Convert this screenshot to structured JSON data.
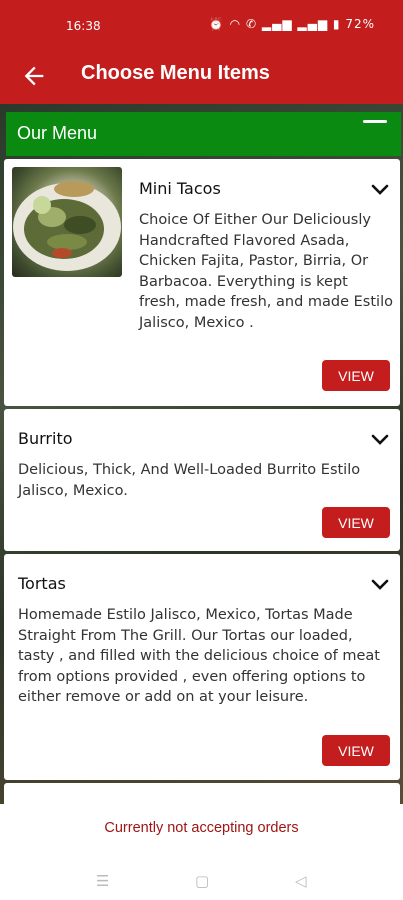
{
  "status_bar": {
    "time": "16:38",
    "icons": [
      "alarm-icon",
      "wifi-icon",
      "call-icon",
      "signal-icon",
      "signal-icon",
      "battery-icon"
    ],
    "battery": "72%"
  },
  "app_bar": {
    "title": "Choose Menu Items",
    "back_icon": "back-arrow-icon"
  },
  "menu_section": {
    "title": "Our Menu"
  },
  "items": [
    {
      "name": "Mini Tacos",
      "description": "Choice Of Either Our Deliciously Handcrafted Flavored Asada, Chicken Fajita, Pastor, Birria, Or Barbacoa. Everything is kept fresh, made fresh, and made Estilo Jalisco, Mexico .",
      "button": "VIEW",
      "has_image": true
    },
    {
      "name": "Burrito",
      "description": "Delicious, Thick,  And Well-Loaded Burrito Estilo Jalisco, Mexico.",
      "button": "VIEW",
      "has_image": false
    },
    {
      "name": "Tortas",
      "description": "Homemade Estilo Jalisco, Mexico, Tortas Made Straight From The Grill. Our Tortas our loaded, tasty , and filled with the delicious choice of meat from options provided , even offering options to either remove or add on at your leisure.",
      "button": "VIEW",
      "has_image": false
    }
  ],
  "footer": {
    "message": "Currently not accepting orders"
  },
  "colors": {
    "primary_red": "#c41d1d",
    "header_green": "#0b8a12",
    "footer_text": "#a01515"
  }
}
